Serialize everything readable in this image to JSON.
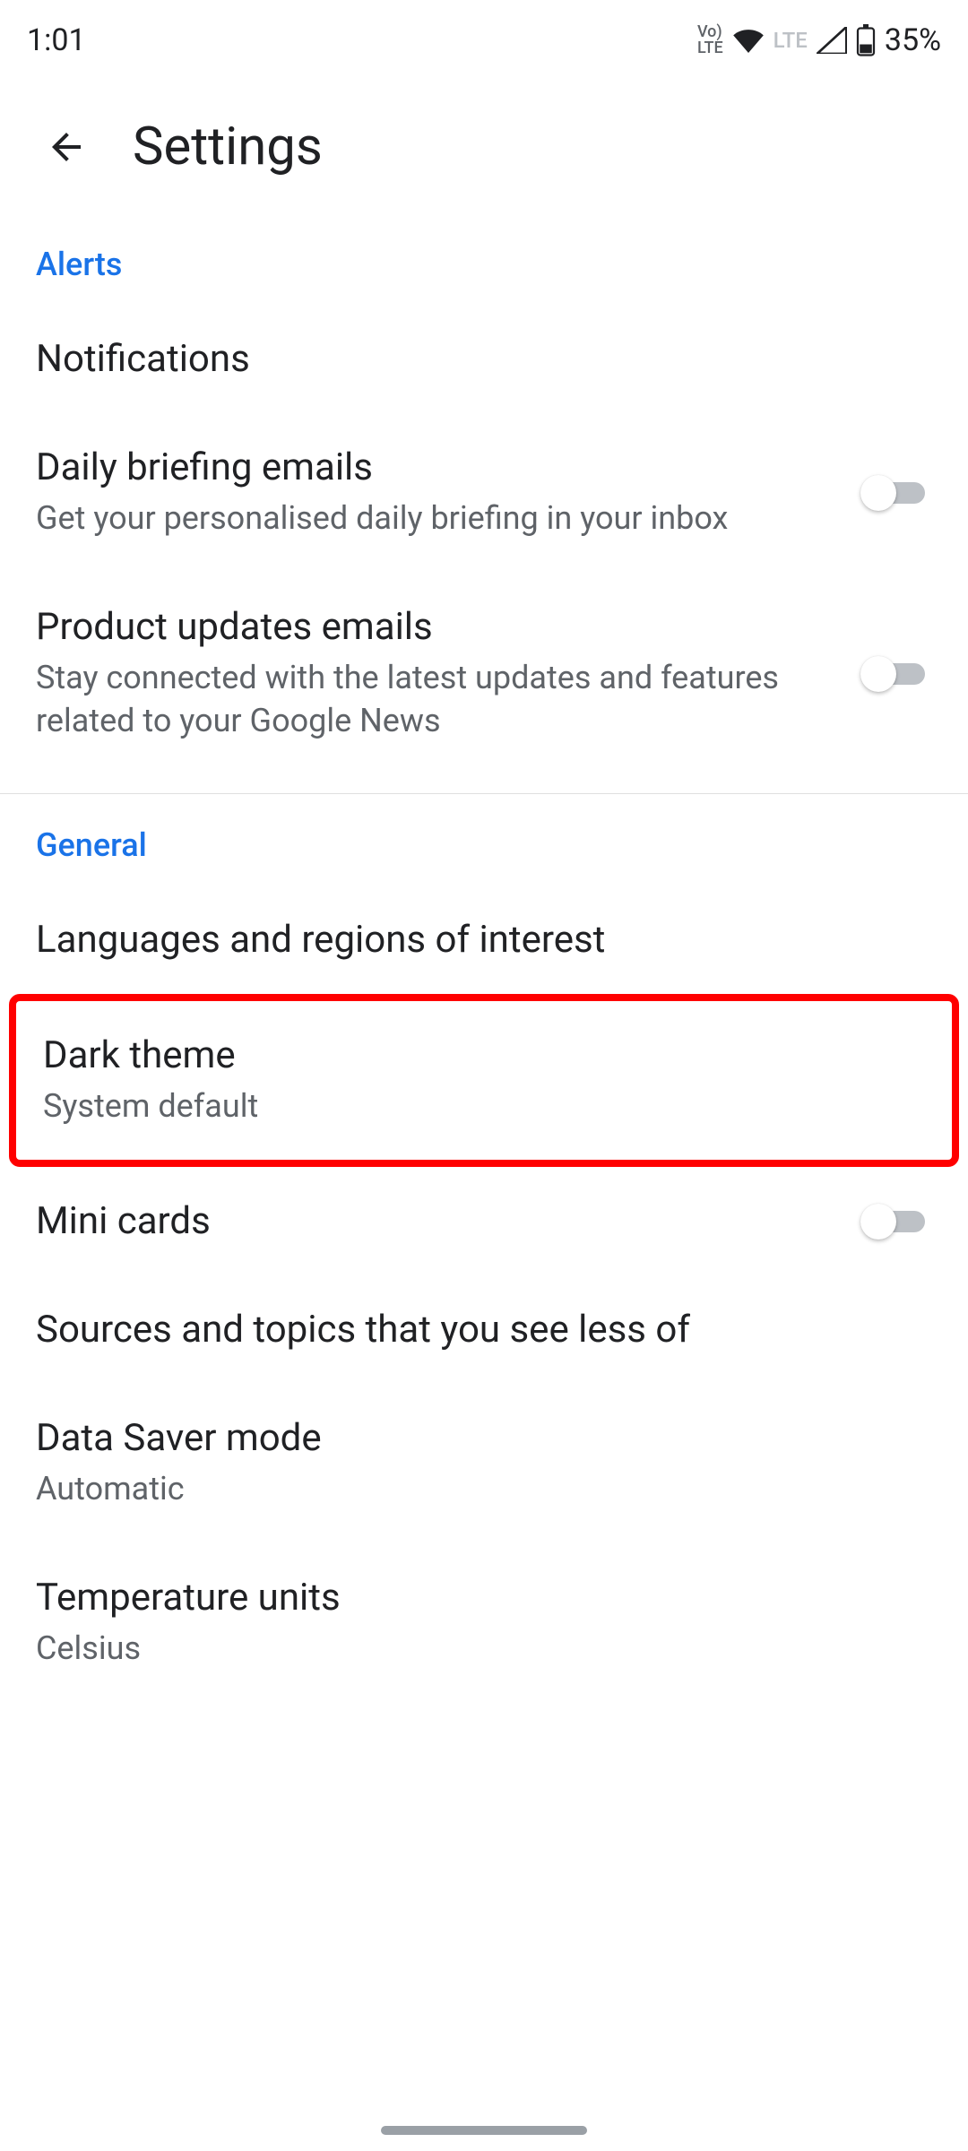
{
  "status": {
    "time": "1:01",
    "volte": "Voℓ\nLTE",
    "lte": "LTE",
    "battery": "35%"
  },
  "header": {
    "title": "Settings"
  },
  "sections": {
    "alerts": {
      "heading": "Alerts",
      "notifications": {
        "title": "Notifications"
      },
      "daily_briefing": {
        "title": "Daily briefing emails",
        "sub": "Get your personalised daily briefing in your inbox"
      },
      "product_updates": {
        "title": "Product updates emails",
        "sub": "Stay connected with the latest updates and features related to your Google News"
      }
    },
    "general": {
      "heading": "General",
      "languages": {
        "title": "Languages and regions of interest"
      },
      "dark_theme": {
        "title": "Dark theme",
        "sub": "System default"
      },
      "mini_cards": {
        "title": "Mini cards"
      },
      "sources": {
        "title": "Sources and topics that you see less of"
      },
      "data_saver": {
        "title": "Data Saver mode",
        "sub": "Automatic"
      },
      "temperature": {
        "title": "Temperature units",
        "sub": "Celsius"
      }
    }
  }
}
